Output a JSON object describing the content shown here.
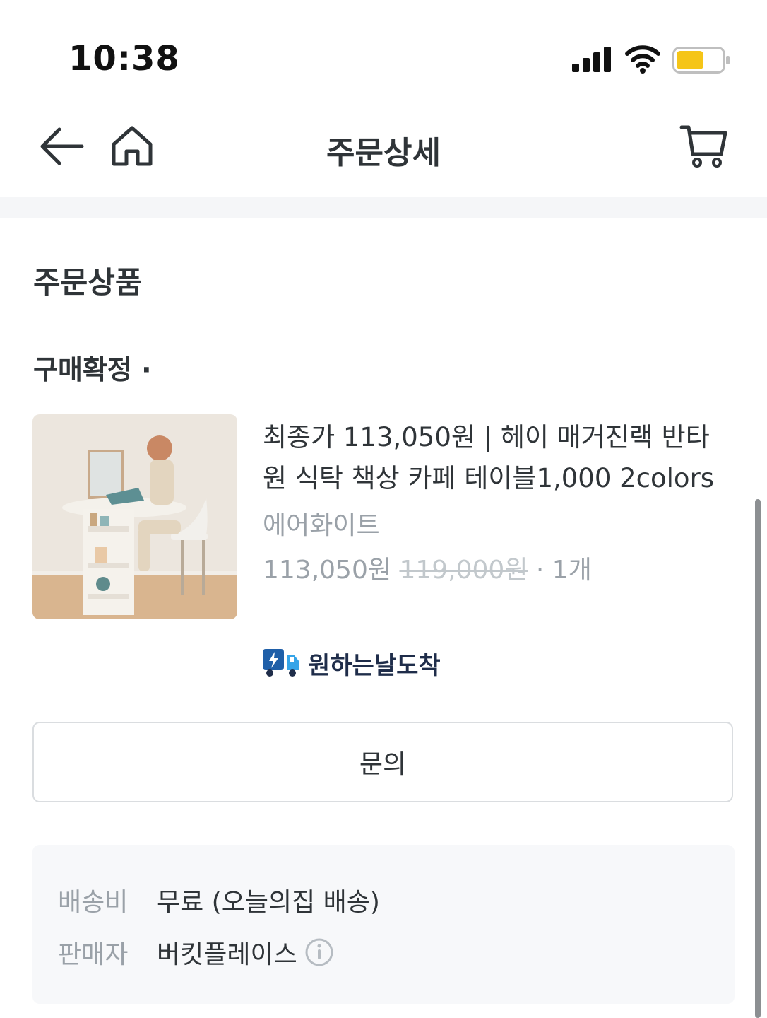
{
  "status_bar": {
    "time": "10:38",
    "battery_color": "#f5c518"
  },
  "nav": {
    "title": "주문상세",
    "back_icon": "arrow-left-icon",
    "home_icon": "home-icon",
    "cart_icon": "cart-icon"
  },
  "section": {
    "title": "주문상품",
    "status": "구매확정 ·"
  },
  "product": {
    "name": "최종가 113,050원 | 헤이 매거진랙 반타원 식탁 책상 카페 테이블1,000 2colors",
    "option": "에어화이트",
    "price": "113,050원",
    "original_price": "119,000원",
    "quantity": "· 1개"
  },
  "delivery": {
    "label": "원하는날도착",
    "icon": "delivery-truck-icon"
  },
  "inquiry": {
    "label": "문의"
  },
  "info": {
    "shipping_label": "배송비",
    "shipping_value": "무료 (오늘의집 배송)",
    "seller_label": "판매자",
    "seller_value": "버킷플레이스",
    "seller_info_icon": "info-icon"
  },
  "colors": {
    "accent": "#35c5f0",
    "text": "#2f3438",
    "muted": "#9aa1a8"
  }
}
